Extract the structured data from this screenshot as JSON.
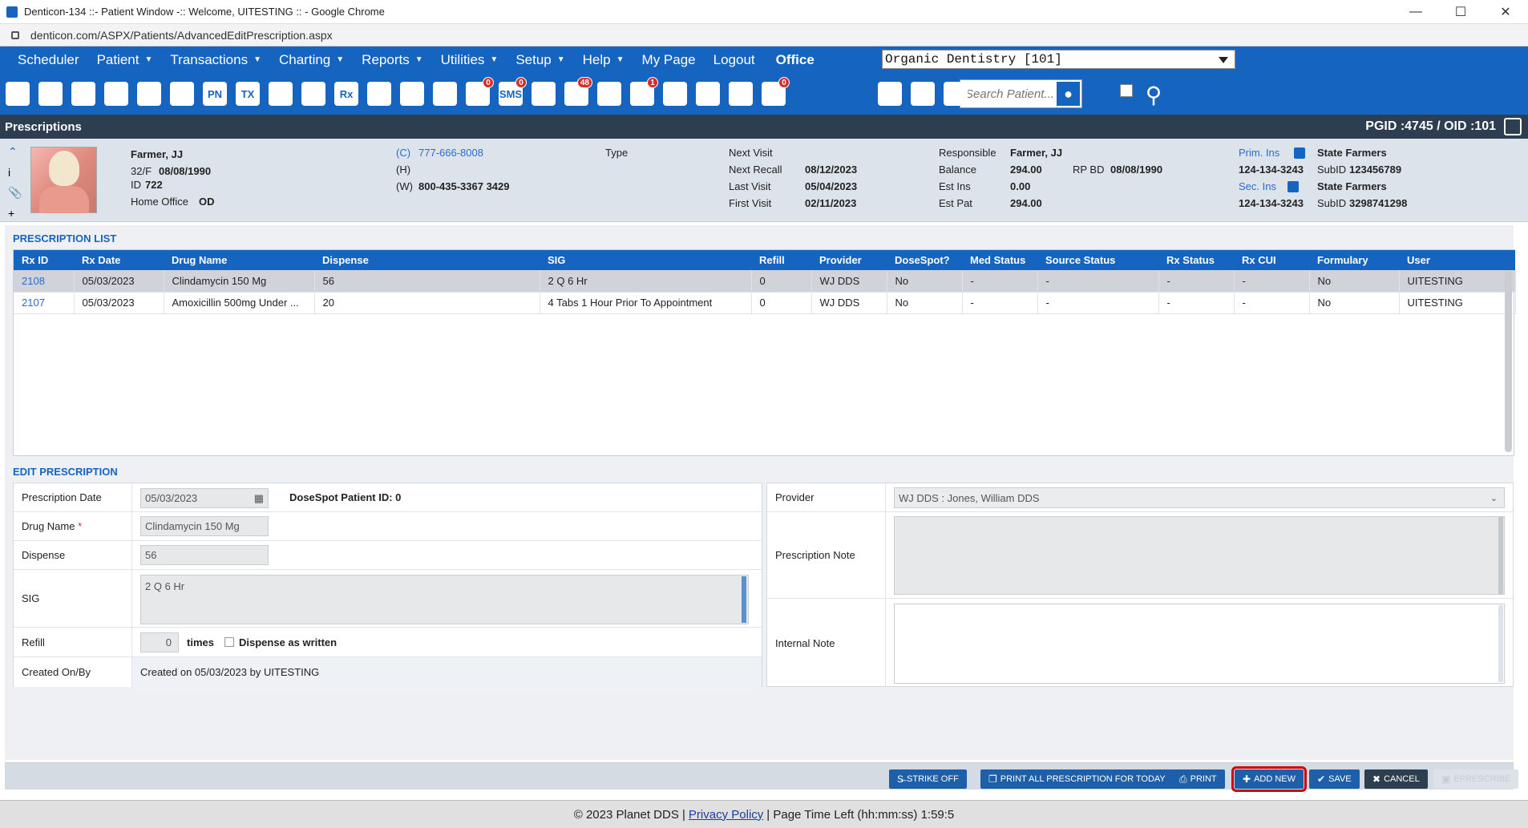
{
  "window": {
    "title": "Denticon-134 ::- Patient Window -:: Welcome, UITESTING :: - Google Chrome",
    "minimize": "—",
    "maximize": "☐",
    "close": "✕"
  },
  "address": {
    "url": "denticon.com/ASPX/Patients/AdvancedEditPrescription.aspx"
  },
  "nav": {
    "items": [
      {
        "label": "Scheduler",
        "dd": false
      },
      {
        "label": "Patient",
        "dd": true
      },
      {
        "label": "Transactions",
        "dd": true
      },
      {
        "label": "Charting",
        "dd": true
      },
      {
        "label": "Reports",
        "dd": true
      },
      {
        "label": "Utilities",
        "dd": true
      },
      {
        "label": "Setup",
        "dd": true
      },
      {
        "label": "Help",
        "dd": true
      },
      {
        "label": "My Page",
        "dd": false
      },
      {
        "label": "Logout",
        "dd": false
      }
    ],
    "office_label": "Office",
    "office_value": "Organic Dentistry [101]"
  },
  "toolbar": {
    "icons": [
      "calendar-icon",
      "home-icon",
      "dollar-icon",
      "chart-pen-icon",
      "tooth-icon",
      "tooth-chart-icon",
      "pn-icon",
      "tx-icon",
      "add-patient-icon",
      "add-group-icon",
      "rx-icon",
      "notes-icon",
      "printer-doc-icon",
      "mail-icon",
      "message-icon",
      "sms-icon",
      "clock-icon",
      "globe-icon",
      "support-icon",
      "recall-icon",
      "dental-icon",
      "question-icon",
      "web-icon",
      "checklist-icon",
      "family-icon",
      "printer-icon",
      "download-icon"
    ],
    "labels": {
      "pn-icon": "PN",
      "tx-icon": "TX",
      "rx-icon": "Rx",
      "sms-icon": "SMS"
    },
    "badges": {
      "message-icon": "0",
      "sms-icon": "0",
      "globe-icon": "48",
      "recall-icon": "1",
      "checklist-icon": "0"
    },
    "search_placeholder": "Search Patient..."
  },
  "pagebar": {
    "title": "Prescriptions",
    "ids": "PGID :4745  /  OID :101"
  },
  "patient": {
    "name": "Farmer, JJ",
    "agesex": "32/F",
    "dob": "08/08/1990",
    "id_label": "ID",
    "id": "722",
    "home_office_label": "Home Office",
    "home_office": "OD",
    "cell_label": "(C)",
    "cell": "777-666-8008",
    "home_label": "(H)",
    "work_label": "(W)",
    "work": "800-435-3367 3429",
    "type_label": "Type",
    "next_visit_label": "Next Visit",
    "next_recall_label": "Next Recall",
    "next_recall": "08/12/2023",
    "last_visit_label": "Last Visit",
    "last_visit": "05/04/2023",
    "first_visit_label": "First Visit",
    "first_visit": "02/11/2023",
    "responsible_label": "Responsible",
    "responsible": "Farmer, JJ",
    "balance_label": "Balance",
    "balance": "294.00",
    "rpbd_label": "RP BD",
    "rpbd": "08/08/1990",
    "estins_label": "Est Ins",
    "estins": "0.00",
    "estpat_label": "Est Pat",
    "estpat": "294.00",
    "prim_ins_label": "Prim. Ins",
    "prim_ins": "State Farmers",
    "prim_phone": "124-134-3243",
    "prim_subid_label": "SubID",
    "prim_subid": "123456789",
    "sec_ins_label": "Sec. Ins",
    "sec_ins": "State Farmers",
    "sec_phone": "124-134-3243",
    "sec_subid_label": "SubID",
    "sec_subid": "3298741298"
  },
  "rx_list": {
    "title": "PRESCRIPTION LIST",
    "columns": [
      "Rx ID",
      "Rx Date",
      "Drug Name",
      "Dispense",
      "SIG",
      "Refill",
      "Provider",
      "DoseSpot?",
      "Med Status",
      "Source Status",
      "Rx Status",
      "Rx CUI",
      "Formulary",
      "User"
    ],
    "rows": [
      [
        "2108",
        "05/03/2023",
        "Clindamycin 150 Mg",
        "56",
        "2 Q 6 Hr",
        "0",
        "WJ DDS",
        "No",
        "-",
        "-",
        "-",
        "-",
        "No",
        "UITESTING"
      ],
      [
        "2107",
        "05/03/2023",
        "Amoxicillin 500mg Under ...",
        "20",
        "4 Tabs 1 Hour Prior To Appointment",
        "0",
        "WJ DDS",
        "No",
        "-",
        "-",
        "-",
        "-",
        "No",
        "UITESTING"
      ]
    ]
  },
  "edit": {
    "title": "EDIT PRESCRIPTION",
    "date_label": "Prescription Date",
    "date": "05/03/2023",
    "dosespot": "DoseSpot Patient ID: 0",
    "drug_label": "Drug Name",
    "drug": "Clindamycin 150 Mg",
    "dispense_label": "Dispense",
    "dispense": "56",
    "sig_label": "SIG",
    "sig": "2 Q 6 Hr",
    "refill_label": "Refill",
    "refill": "0",
    "times": "times",
    "daw": "Dispense as written",
    "created_label": "Created On/By",
    "created": "Created on 05/03/2023 by UITESTING",
    "provider_label": "Provider",
    "provider": "WJ DDS : Jones, William DDS",
    "note_label": "Prescription Note",
    "internal_label": "Internal Note"
  },
  "buttons": {
    "strike": "STRIKE OFF",
    "printall": "PRINT ALL PRESCRIPTION FOR TODAY",
    "print": "PRINT",
    "addnew": "ADD NEW",
    "save": "SAVE",
    "cancel": "CANCEL",
    "eprescribe": "EPRESCRIBE"
  },
  "footer": {
    "copy": "© 2023 Planet DDS |",
    "privacy": "Privacy Policy",
    "time": "|  Page Time Left (hh:mm:ss) 1:59:5"
  }
}
